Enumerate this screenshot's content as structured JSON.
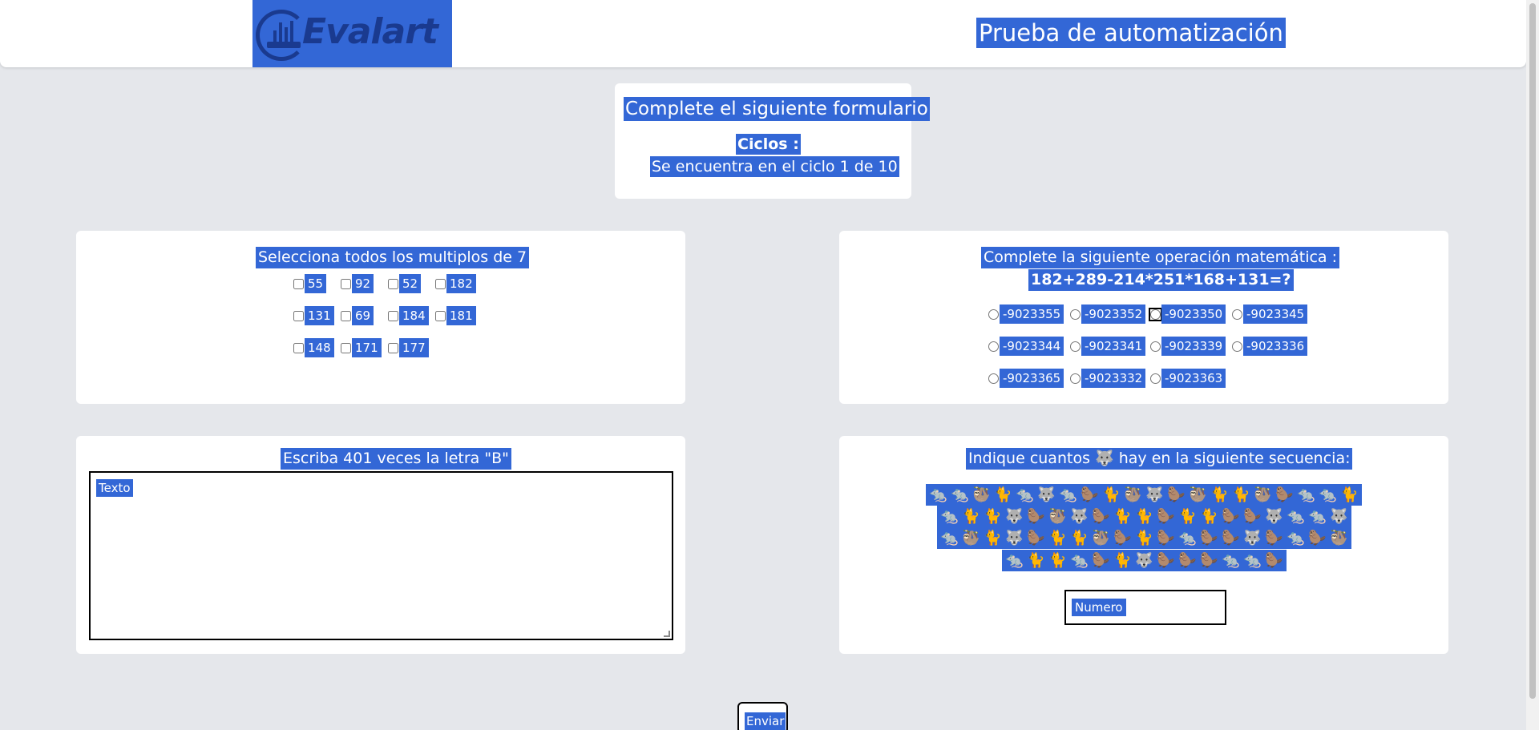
{
  "header": {
    "logo_text": "Evalart",
    "page_title": "Prueba de automatización"
  },
  "info": {
    "heading": "Complete el siguiente formulario",
    "cycles_label": "Ciclos :",
    "cycles_text": "Se encuentra en el ciclo 1 de 10"
  },
  "multiples_card": {
    "title": "Selecciona todos los multiplos de 7",
    "options": [
      "55",
      "92",
      "52",
      "182",
      "131",
      "69",
      "184",
      "181",
      "148",
      "171",
      "177"
    ]
  },
  "math_card": {
    "title": "Complete la siguiente operación matemática :",
    "expression": "182+289-214*251*168+131=?",
    "options": [
      "-9023355",
      "-9023352",
      "-9023350",
      "-9023345",
      "-9023344",
      "-9023341",
      "-9023339",
      "-9023336",
      "-9023365",
      "-9023332",
      "-9023363"
    ],
    "focused_option": "-9023350"
  },
  "text_card": {
    "title": "Escriba 401 veces la letra \"B\"",
    "placeholder": "Texto"
  },
  "sequence_card": {
    "title_before": "Indique cuantos",
    "title_emoji": "🐺",
    "title_after": "hay en la siguiente secuencia:",
    "rows": [
      [
        "🐀",
        "🐀",
        "🦥",
        "🐈",
        "🐀",
        "🐺",
        "🐀",
        "🦫",
        "🐈",
        "🦥",
        "🐺",
        "🦫",
        "🦥",
        "🐈",
        "🐈",
        "🦥",
        "🦫",
        "🐀",
        "🐀",
        "🐈"
      ],
      [
        "🐀",
        "🐈",
        "🐈",
        "🐺",
        "🦫",
        "🦥",
        "🐺",
        "🦫",
        "🐈",
        "🐈",
        "🦫",
        "🐈",
        "🐈",
        "🦫",
        "🦫",
        "🐺",
        "🐀",
        "🐀",
        "🐺"
      ],
      [
        "🐀",
        "🦥",
        "🐈",
        "🐺",
        "🦫",
        "🐈",
        "🐈",
        "🦥",
        "🦫",
        "🐈",
        "🦫",
        "🐀",
        "🦫",
        "🦫",
        "🐺",
        "🦫",
        "🐀",
        "🦫",
        "🦥"
      ],
      [
        "🐀",
        "🐈",
        "🐈",
        "🐀",
        "🦫",
        "🐈",
        "🐺",
        "🦫",
        "🦫",
        "🦫",
        "🐀",
        "🐀",
        "🦫"
      ]
    ],
    "number_placeholder": "Numero"
  },
  "submit": {
    "label": "Enviar"
  }
}
